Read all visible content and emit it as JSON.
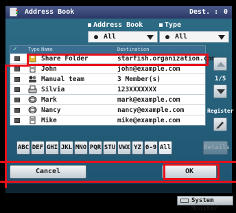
{
  "header": {
    "title": "Address Book",
    "dest_label": "Dest. :",
    "dest_count": "0"
  },
  "filters": {
    "address_book": {
      "label": "Address Book",
      "value": "All"
    },
    "type": {
      "label": "Type",
      "value": "All"
    }
  },
  "table": {
    "columns": [
      "Type",
      "Name",
      "Destination"
    ],
    "rows": [
      {
        "icon": "folder-icon",
        "name": "Share Folder",
        "destination": "starfish.organization.com",
        "selected": true
      },
      {
        "icon": "document-icon",
        "name": "John",
        "destination": "john@example.com",
        "selected": false
      },
      {
        "icon": "group-icon",
        "name": "Manual team",
        "destination": "3 Member(s)",
        "selected": false
      },
      {
        "icon": "fax-icon",
        "name": "Silvia",
        "destination": "123XXXXXXX",
        "selected": false
      },
      {
        "icon": "email-icon",
        "name": "Mark",
        "destination": "mark@example.com",
        "selected": false
      },
      {
        "icon": "email-icon",
        "name": "Nancy",
        "destination": "nancy@example.com",
        "selected": false
      },
      {
        "icon": "document-icon",
        "name": "Mike",
        "destination": "mike@example.com",
        "selected": false
      }
    ]
  },
  "pagination": {
    "page": "1/5"
  },
  "register_label": "Register",
  "alpha_tabs": [
    "ABC",
    "DEF",
    "GHI",
    "JKL",
    "MNO",
    "PQR",
    "STU",
    "VWX",
    "YZ",
    "0-9",
    "All"
  ],
  "details_label": "Details",
  "buttons": {
    "cancel": "Cancel",
    "ok": "OK"
  },
  "system_monitor": "System Monitor",
  "colors": {
    "highlight": "#e8101a",
    "title_bar": "#2b3866",
    "panel": "#2d6b84"
  }
}
